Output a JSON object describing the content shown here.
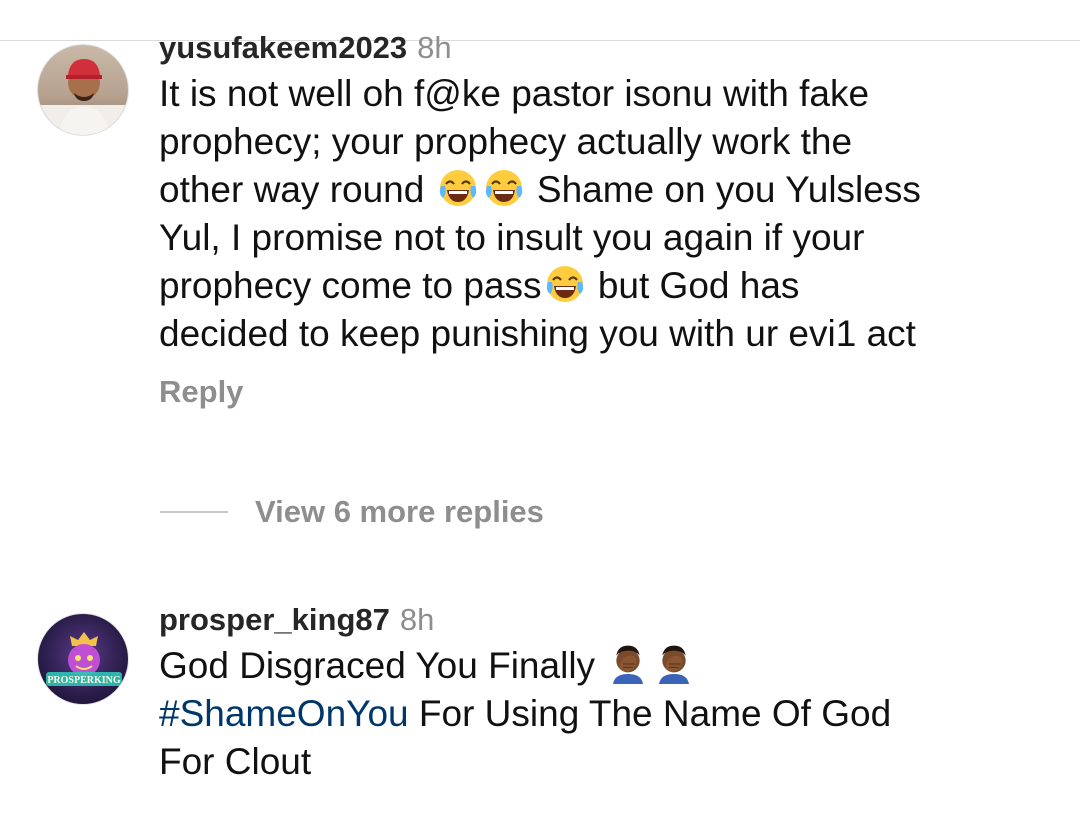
{
  "comments": [
    {
      "username": "yusufakeem2023",
      "time": "8h",
      "lines": [
        "It is not well oh f@ke pastor isonu with fake",
        "prophecy; your prophecy actually work the",
        "other way round",
        "Shame on you Yulsless",
        "Yul, I promise not to insult you again if your",
        "prophecy come to pass",
        "but God has",
        "decided to keep punishing you with ur evi1 act"
      ],
      "reply_label": "Reply"
    },
    {
      "username": "prosper_king87",
      "time": "8h",
      "avatar_text": "PROSPERKING",
      "lines": [
        "God Disgraced You Finally",
        "#ShameOnYou",
        "For Using The Name Of God",
        "For Clout"
      ]
    }
  ],
  "view_more_label": "View 6 more replies",
  "emoji": {
    "laugh": "face-with-tears-of-joy",
    "facepalm": "person-facepalming"
  },
  "colors": {
    "hashtag": "#00376b",
    "muted": "#8e8e8e",
    "username": "#262626"
  }
}
